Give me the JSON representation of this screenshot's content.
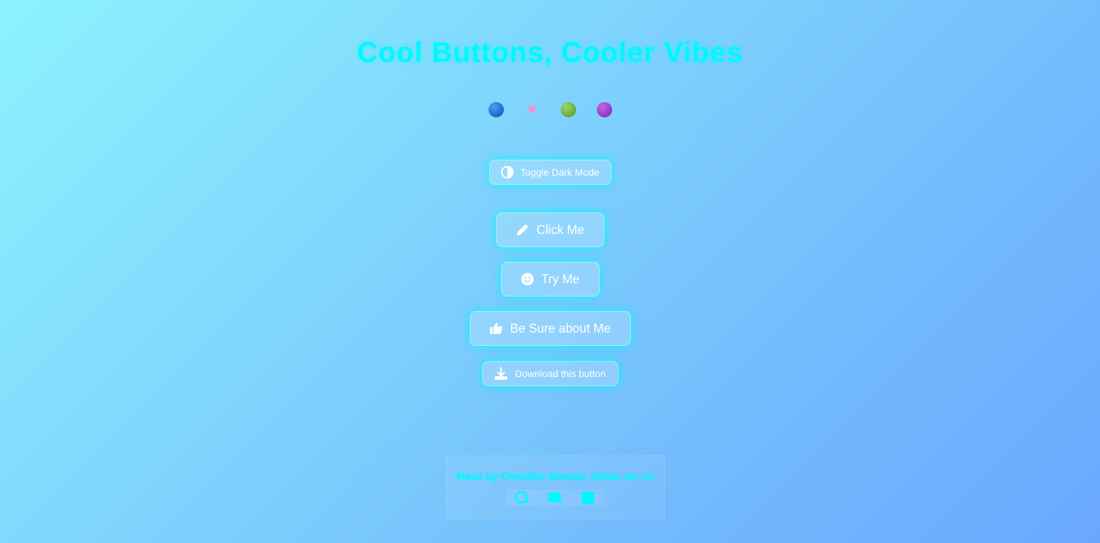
{
  "page": {
    "title": "Cool Buttons, Cooler Vibes"
  },
  "theme_options": [
    {
      "name": "blue-circle",
      "color": "#1a6fd4"
    },
    {
      "name": "pink-heart",
      "color": "#ff8dc6"
    },
    {
      "name": "green-circle",
      "color": "#6db33f"
    },
    {
      "name": "purple-circle",
      "color": "#9a3bc7"
    }
  ],
  "buttons": {
    "toggle_dark_mode": {
      "label": "Toggle Dark Mode",
      "icon": "half-circle-icon"
    },
    "click_me": {
      "label": "Click Me",
      "icon": "pencil-icon"
    },
    "try_me": {
      "label": "Try Me",
      "icon": "smiley-icon"
    },
    "be_sure": {
      "label": "Be Sure about Me",
      "icon": "thumbs-up-icon"
    },
    "download": {
      "label": "Download this button",
      "icon": "download-icon"
    }
  },
  "footer": {
    "text": "Made by Christine Mworia, follow me on",
    "social_icons": [
      "github-icon",
      "codepen-icon",
      "linkedin-icon"
    ]
  },
  "colors": {
    "accent": "#00f7ff",
    "background_start": "#8cf3fd",
    "background_end": "#6aa8fe"
  }
}
